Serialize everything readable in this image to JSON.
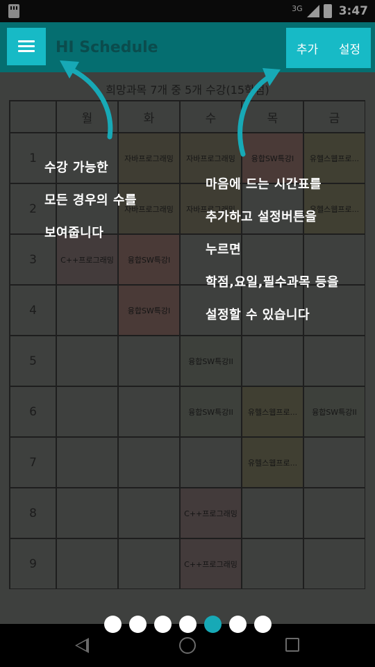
{
  "status_bar": {
    "network": "3G",
    "time": "3:47"
  },
  "app_bar": {
    "title": "HI Schedule",
    "actions": [
      "추가",
      "설정"
    ]
  },
  "summary": "희망과목 7개 중 5개 수강(15학점)",
  "timetable": {
    "days": [
      "월",
      "화",
      "수",
      "목",
      "금"
    ],
    "periods": [
      "1",
      "2",
      "3",
      "4",
      "5",
      "6",
      "7",
      "8",
      "9"
    ],
    "cells": [
      [
        "",
        "자바프로그래밍",
        "자바프로그래밍",
        "융합SW특강I",
        "유헬스웹프로..."
      ],
      [
        "",
        "자바프로그래밍",
        "자바프로그래밍",
        "",
        "유헬스웹프로..."
      ],
      [
        "C++프로그래밍",
        "융합SW특강I",
        "",
        "",
        ""
      ],
      [
        "",
        "융합SW특강I",
        "",
        "",
        ""
      ],
      [
        "",
        "",
        "융합SW특강II",
        "",
        ""
      ],
      [
        "",
        "",
        "융합SW특강II",
        "유헬스웹프로...",
        "융합SW특강II"
      ],
      [
        "",
        "",
        "",
        "유헬스웹프로...",
        ""
      ],
      [
        "",
        "",
        "C++프로그래밍",
        "",
        ""
      ],
      [
        "",
        "",
        "C++프로그래밍",
        "",
        ""
      ]
    ]
  },
  "tutorial": {
    "left_note": [
      "수강 가능한",
      "모든 경우의 수를",
      "보여줍니다"
    ],
    "right_note": [
      "마음에 드는 시간표를",
      "추가하고 설정버튼을",
      "누르면",
      "학점,요일,필수과목 등을",
      "설정할 수 있습니다"
    ]
  },
  "pager": {
    "total": 7,
    "active_index": 4
  },
  "colors": {
    "accent": "#17bac6",
    "app_bar": "#056e70",
    "content_dim": "#3e403e",
    "course_java": "#3f3d33",
    "course_cpp": "#433b3b",
    "course_sw1": "#4a3a37",
    "course_sw2": "#3d403b",
    "course_uhealth": "#403f32"
  }
}
